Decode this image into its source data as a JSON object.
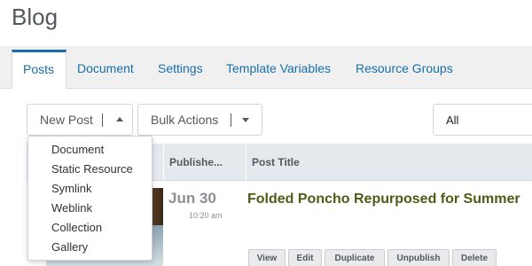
{
  "header": {
    "title": "Blog"
  },
  "tabs": [
    {
      "label": "Posts",
      "active": true
    },
    {
      "label": "Document"
    },
    {
      "label": "Settings"
    },
    {
      "label": "Template Variables"
    },
    {
      "label": "Resource Groups"
    }
  ],
  "toolbar": {
    "new_post_label": "New Post",
    "bulk_actions_label": "Bulk Actions",
    "filter_value": "All"
  },
  "grid": {
    "columns": [
      "Publishe...",
      "Post Title"
    ],
    "rows": [
      {
        "date_day": "Jun 30",
        "date_time": "10:20 am",
        "title": "Folded Poncho Repurposed for Summer",
        "actions": [
          "View",
          "Edit",
          "Duplicate",
          "Unpublish",
          "Delete"
        ]
      }
    ]
  },
  "new_post_menu": {
    "items": [
      "Document",
      "Static Resource",
      "Symlink",
      "Weblink",
      "Collection",
      "Gallery"
    ]
  },
  "colors": {
    "accent": "#1a6ea8",
    "title_green": "#4d5c15",
    "grid_header": "#e4e9ee"
  }
}
